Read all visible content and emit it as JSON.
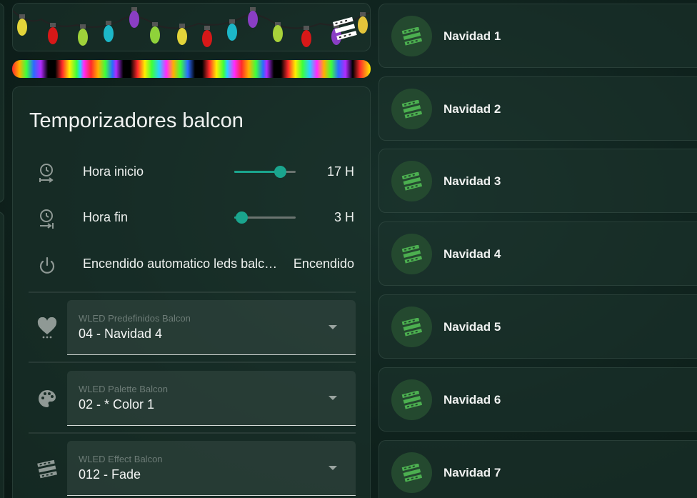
{
  "timers": {
    "title": "Temporizadores balcon",
    "rows": [
      {
        "label": "Hora inicio",
        "value": "17 H",
        "slider_fraction": 0.74
      },
      {
        "label": "Hora fin",
        "value": "3 H",
        "slider_fraction": 0.12
      },
      {
        "label": "Encendido automatico leds balc…",
        "value": "Encendido"
      }
    ],
    "selects": [
      {
        "label": "WLED Predefinidos Balcon",
        "value": "04 - Navidad 4",
        "icon": "heart-icon"
      },
      {
        "label": "WLED Palette Balcon",
        "value": "02 - * Color 1",
        "icon": "palette-icon"
      },
      {
        "label": "WLED Effect Balcon",
        "value": "012 - Fade",
        "icon": "film-effect-icon"
      }
    ]
  },
  "scenes": [
    {
      "name": "Navidad 1"
    },
    {
      "name": "Navidad 2"
    },
    {
      "name": "Navidad 3"
    },
    {
      "name": "Navidad 4"
    },
    {
      "name": "Navidad 5"
    },
    {
      "name": "Navidad 6"
    },
    {
      "name": "Navidad 7"
    }
  ],
  "colors": {
    "accent": "#1aa58e",
    "scene_badge_bg": "#24492f",
    "scene_icon": "#4caf50"
  }
}
